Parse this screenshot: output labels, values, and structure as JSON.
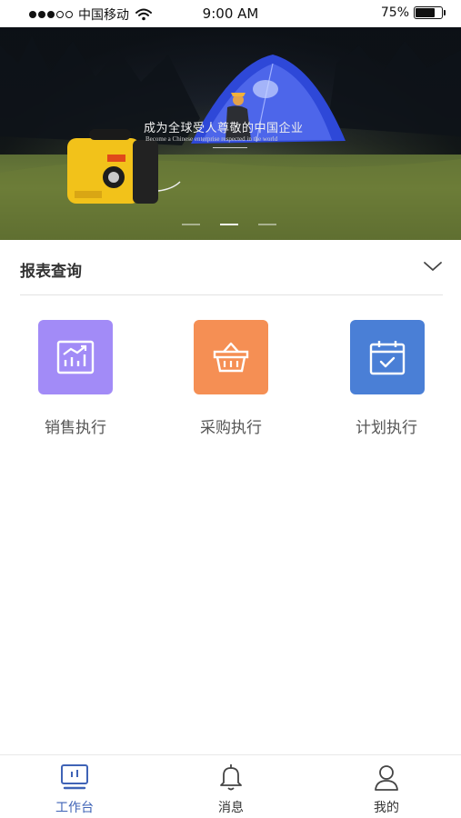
{
  "status_bar": {
    "carrier": "中国移动",
    "time": "9:00 AM",
    "battery_percent": "75%",
    "battery_level": 0.75,
    "signal_filled": 3,
    "signal_total": 5
  },
  "banner": {
    "title": "成为全球受人尊敬的中国企业",
    "subtitle": "Become a Chinese enterprise respected in the world",
    "slides_count": 3,
    "active_slide": 1
  },
  "report": {
    "title": "报表查询",
    "expand_icon": "chevron-down-icon",
    "items": [
      {
        "label": "销售执行",
        "icon": "chart-icon",
        "color": "#a28bf7"
      },
      {
        "label": "采购执行",
        "icon": "basket-icon",
        "color": "#f58f54"
      },
      {
        "label": "计划执行",
        "icon": "calendar-check-icon",
        "color": "#4a7fd6"
      }
    ]
  },
  "tabbar": {
    "active_color": "#3f63b6",
    "items": [
      {
        "label": "工作台",
        "icon": "workbench-icon",
        "active": true
      },
      {
        "label": "消息",
        "icon": "bell-icon",
        "active": false
      },
      {
        "label": "我的",
        "icon": "user-icon",
        "active": false
      }
    ]
  }
}
